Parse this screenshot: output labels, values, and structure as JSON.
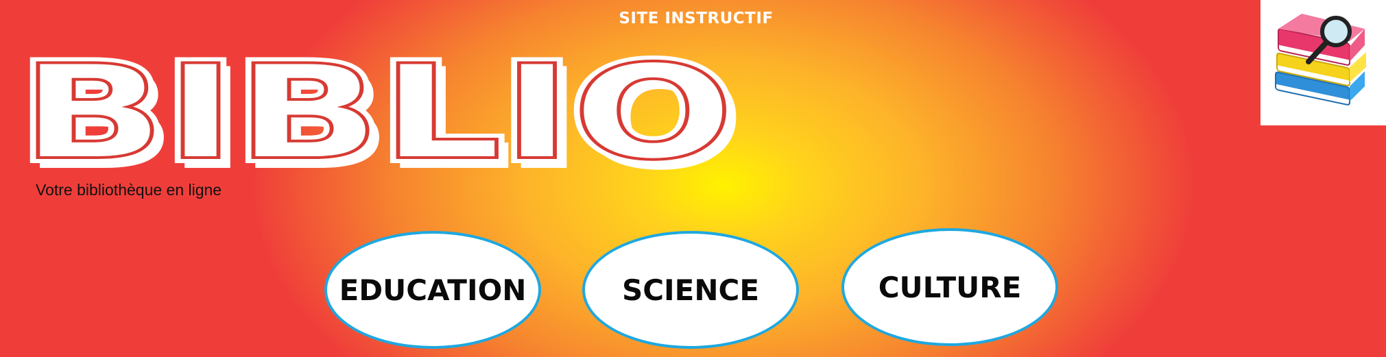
{
  "header": {
    "tagline": "SITE INSTRUCTIF",
    "brand": "BIBLIO",
    "subtitle": "Votre bibliothèque en ligne"
  },
  "categories": [
    {
      "label": "EDUCATION"
    },
    {
      "label": "SCIENCE"
    },
    {
      "label": "CULTURE"
    }
  ],
  "colors": {
    "banner_edge": "#ef3e3a",
    "banner_center": "#fff200",
    "ellipse_border": "#1ea8e0",
    "logo_outline": "#ffffff"
  },
  "icons": {
    "books": "stacked-books-magnifier-icon"
  }
}
